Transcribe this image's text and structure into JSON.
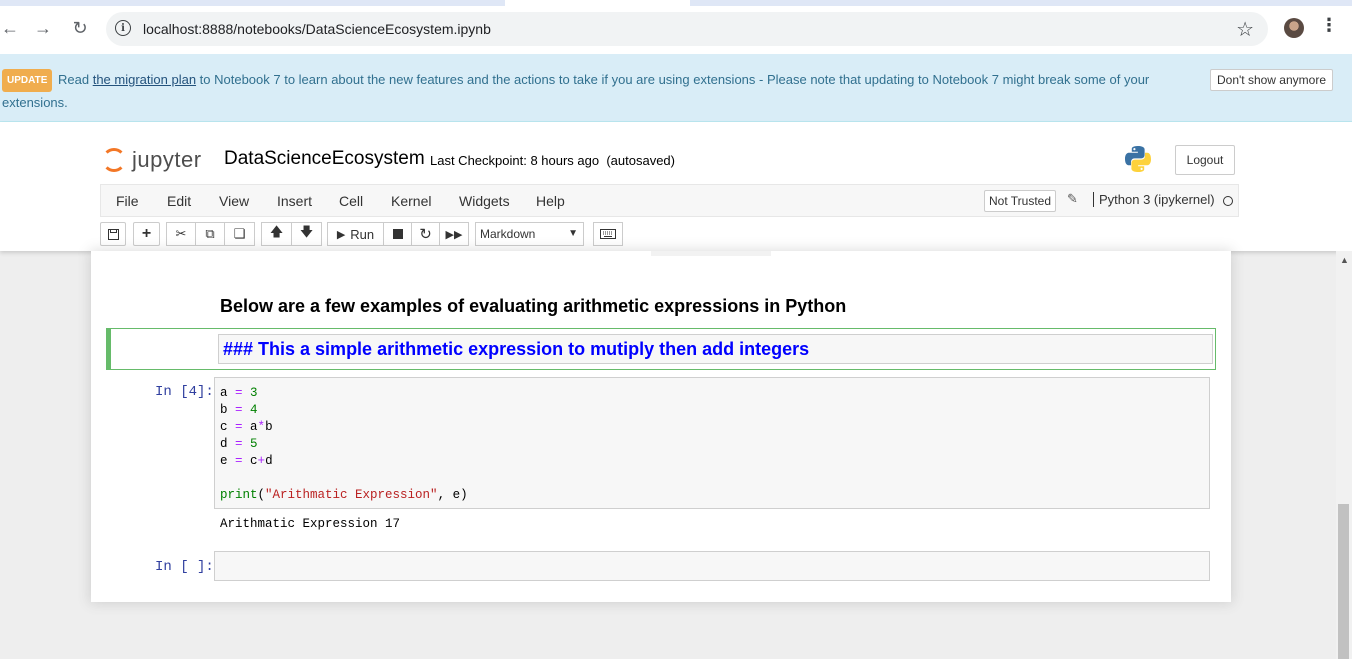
{
  "browser": {
    "url": "localhost:8888/notebooks/DataScienceEcosystem.ipynb"
  },
  "banner": {
    "badge": "UPDATE",
    "text_before": "Read ",
    "link": "the migration plan",
    "text_after": " to Notebook 7 to learn about the new features and the actions to take if you are using extensions - Please note that updating to Notebook 7 might break some of your extensions.",
    "dismiss": "Don't show anymore"
  },
  "header": {
    "logo_text": "jupyter",
    "notebook_name": "DataScienceEcosystem",
    "checkpoint": "Last Checkpoint: 8 hours ago",
    "autosave": "(autosaved)",
    "logout": "Logout"
  },
  "menu": {
    "items": [
      "File",
      "Edit",
      "View",
      "Insert",
      "Cell",
      "Kernel",
      "Widgets",
      "Help"
    ],
    "trust": "Not Trusted",
    "kernel": "Python 3 (ipykernel)"
  },
  "toolbar": {
    "run_label": "Run",
    "cell_type": "Markdown"
  },
  "cells": {
    "md_rendered": "Below are a few examples of evaluating arithmetic expressions in Python",
    "md_editing": "### This a simple arithmetic expression to mutiply then add integers",
    "code_prompt": "In [4]:",
    "code_lines": [
      "a = 3",
      "b = 4",
      "c = a*b",
      "d = 5",
      "e = c+d",
      "",
      "print(\"Arithmatic Expression\", e)"
    ],
    "output": "Arithmatic Expression 17",
    "empty_prompt": "In [ ]:"
  }
}
